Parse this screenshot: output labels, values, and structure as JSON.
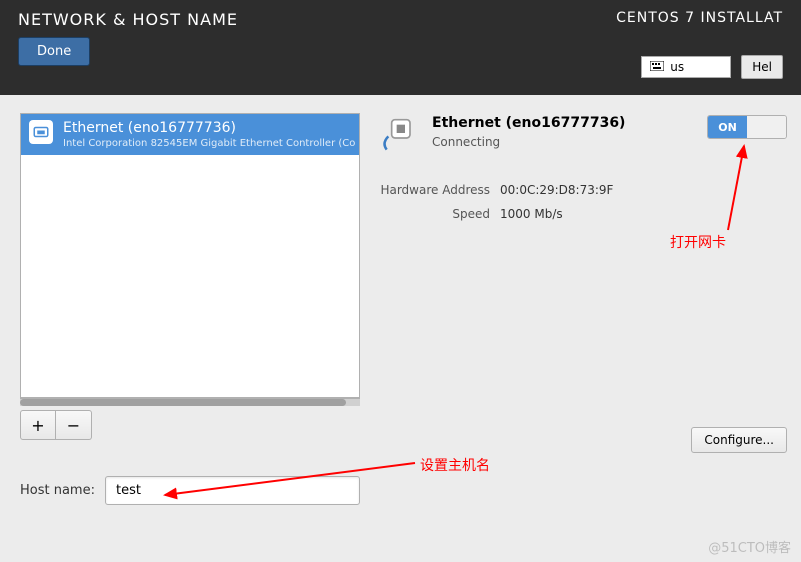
{
  "header": {
    "title": "NETWORK & HOST NAME",
    "done": "Done",
    "product": "CENTOS 7 INSTALLAT",
    "keyboard": "us",
    "help": "Hel"
  },
  "nic_list": {
    "items": [
      {
        "title": "Ethernet (eno16777736)",
        "subtitle": "Intel Corporation 82545EM Gigabit Ethernet Controller (Co"
      }
    ],
    "plus": "+",
    "minus": "−"
  },
  "details": {
    "title": "Ethernet (eno16777736)",
    "status": "Connecting",
    "toggle_on": "ON",
    "toggle_off": "",
    "hw_label": "Hardware Address",
    "hw_value": "00:0C:29:D8:73:9F",
    "speed_label": "Speed",
    "speed_value": "1000 Mb/s",
    "configure": "Configure..."
  },
  "hostname": {
    "label": "Host name:",
    "value": "test"
  },
  "annotations": {
    "open_nic": "打开网卡",
    "set_host": "设置主机名"
  },
  "watermark": "@51CTO博客"
}
